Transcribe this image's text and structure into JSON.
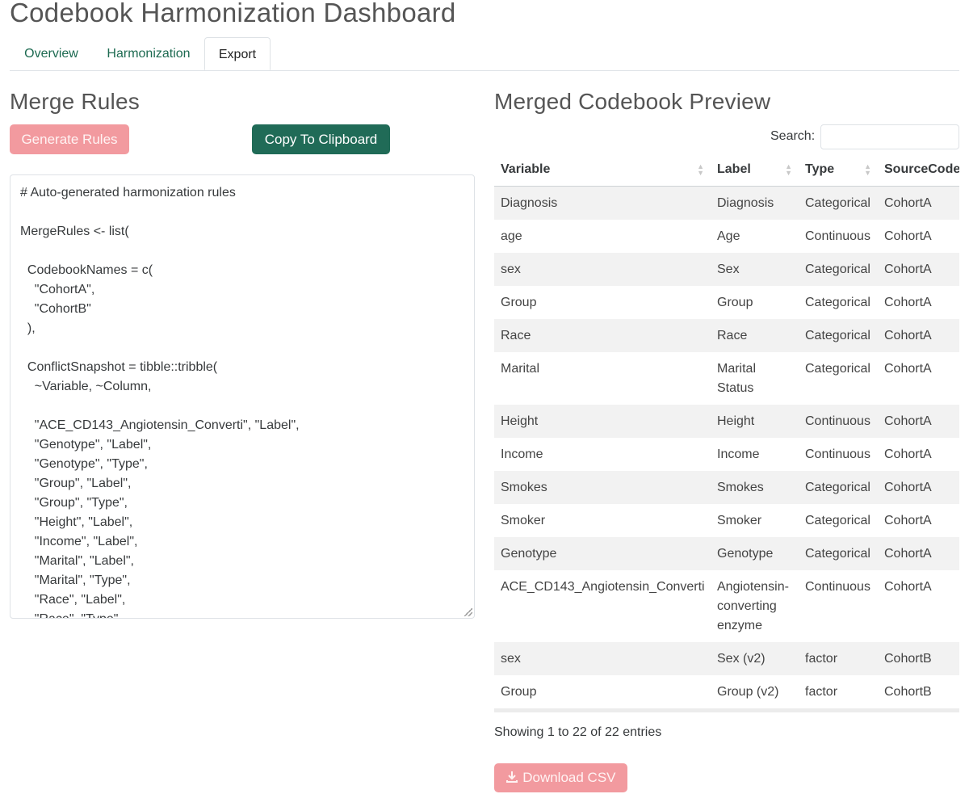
{
  "app": {
    "title": "Codebook Harmonization Dashboard"
  },
  "tabs": [
    {
      "label": "Overview",
      "active": false
    },
    {
      "label": "Harmonization",
      "active": false
    },
    {
      "label": "Export",
      "active": true
    }
  ],
  "merge_rules": {
    "title": "Merge Rules",
    "generate_label": "Generate Rules",
    "copy_label": "Copy To Clipboard",
    "code": "# Auto-generated harmonization rules\n\nMergeRules <- list(\n\n  CodebookNames = c(\n    \"CohortA\",\n    \"CohortB\"\n  ),\n\n  ConflictSnapshot = tibble::tribble(\n    ~Variable, ~Column,\n\n    \"ACE_CD143_Angiotensin_Converti\", \"Label\",\n    \"Genotype\", \"Label\",\n    \"Genotype\", \"Type\",\n    \"Group\", \"Label\",\n    \"Group\", \"Type\",\n    \"Height\", \"Label\",\n    \"Income\", \"Label\",\n    \"Marital\", \"Label\",\n    \"Marital\", \"Type\",\n    \"Race\", \"Label\",\n    \"Race\", \"Type\","
  },
  "preview": {
    "title": "Merged Codebook Preview",
    "search_label": "Search:",
    "search_value": "",
    "columns": [
      "Variable",
      "Label",
      "Type",
      "SourceCodebook"
    ],
    "rows": [
      [
        "Diagnosis",
        "Diagnosis",
        "Categorical",
        "CohortA"
      ],
      [
        "age",
        "Age",
        "Continuous",
        "CohortA"
      ],
      [
        "sex",
        "Sex",
        "Categorical",
        "CohortA"
      ],
      [
        "Group",
        "Group",
        "Categorical",
        "CohortA"
      ],
      [
        "Race",
        "Race",
        "Categorical",
        "CohortA"
      ],
      [
        "Marital",
        "Marital Status",
        "Categorical",
        "CohortA"
      ],
      [
        "Height",
        "Height",
        "Continuous",
        "CohortA"
      ],
      [
        "Income",
        "Income",
        "Continuous",
        "CohortA"
      ],
      [
        "Smokes",
        "Smokes",
        "Categorical",
        "CohortA"
      ],
      [
        "Smoker",
        "Smoker",
        "Categorical",
        "CohortA"
      ],
      [
        "Genotype",
        "Genotype",
        "Categorical",
        "CohortA"
      ],
      [
        "ACE_CD143_Angiotensin_Converti",
        "Angiotensin-converting enzyme",
        "Continuous",
        "CohortA"
      ],
      [
        "sex",
        "Sex (v2)",
        "factor",
        "CohortB"
      ],
      [
        "Group",
        "Group (v2)",
        "factor",
        "CohortB"
      ]
    ],
    "info": "Showing 1 to 22 of 22 entries",
    "download_label": "Download CSV"
  }
}
